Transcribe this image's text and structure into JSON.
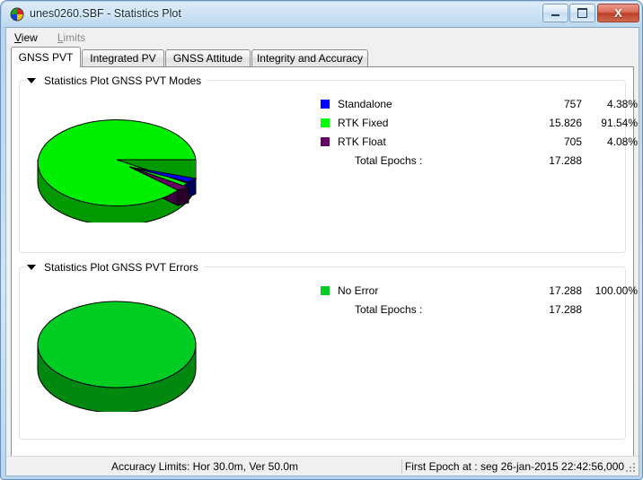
{
  "window": {
    "title": "unes0260.SBF - Statistics Plot",
    "icon": "pie-chart-app-icon",
    "buttons": {
      "minimize": "minimize-icon",
      "maximize": "maximize-icon",
      "close": "X"
    }
  },
  "menubar": {
    "items": [
      {
        "label": "View",
        "mnemonic": "V",
        "rest": "iew",
        "disabled": false
      },
      {
        "label": "Limits",
        "mnemonic": "L",
        "rest": "imits",
        "disabled": true
      }
    ]
  },
  "tabs": [
    {
      "label": "GNSS PVT",
      "active": true
    },
    {
      "label": "Integrated PV",
      "active": false
    },
    {
      "label": "GNSS Attitude",
      "active": false
    },
    {
      "label": "Integrity and Accuracy",
      "active": false
    }
  ],
  "groups": [
    {
      "title": "Statistics Plot GNSS PVT Modes"
    },
    {
      "title": "Statistics Plot GNSS PVT Errors"
    }
  ],
  "legend_modes": {
    "rows": [
      {
        "label": "Standalone",
        "color": "#0000FF",
        "count": "757",
        "pct": "4.38%"
      },
      {
        "label": "RTK Fixed",
        "color": "#00FF00",
        "count": "15.826",
        "pct": "91.54%"
      },
      {
        "label": "RTK Float",
        "color": "#660066",
        "count": "705",
        "pct": "4.08%"
      }
    ],
    "total_label": "Total Epochs :",
    "total_value": "17.288"
  },
  "legend_errors": {
    "rows": [
      {
        "label": "No Error",
        "color": "#00CC22",
        "count": "17.288",
        "pct": "100.00%"
      }
    ],
    "total_label": "Total Epochs :",
    "total_value": "17.288"
  },
  "statusbar": {
    "accuracy_limits": "Accuracy Limits: Hor 30.0m, Ver 50.0m",
    "first_epoch": "First Epoch at : seg 26-jan-2015 22:42:56,000"
  },
  "chart_data": [
    {
      "type": "pie",
      "title": "Statistics Plot GNSS PVT Modes",
      "style": "3d-exploded",
      "legend_position": "right",
      "total": 17288,
      "total_label": "Total Epochs :",
      "categories": [
        "Standalone",
        "RTK Fixed",
        "RTK Float"
      ],
      "values": [
        757,
        15826,
        705
      ],
      "percents": [
        4.38,
        91.54,
        4.08
      ],
      "colors": [
        "#0000FF",
        "#00EE00",
        "#660066"
      ],
      "side_colors": [
        "#00007F",
        "#009900",
        "#330033"
      ],
      "exploded": [
        true,
        false,
        true
      ]
    },
    {
      "type": "pie",
      "title": "Statistics Plot GNSS PVT Errors",
      "style": "3d",
      "legend_position": "right",
      "total": 17288,
      "total_label": "Total Epochs :",
      "categories": [
        "No Error"
      ],
      "values": [
        17288
      ],
      "percents": [
        100.0
      ],
      "colors": [
        "#00CC22"
      ],
      "side_colors": [
        "#008811"
      ],
      "exploded": [
        false
      ]
    }
  ]
}
